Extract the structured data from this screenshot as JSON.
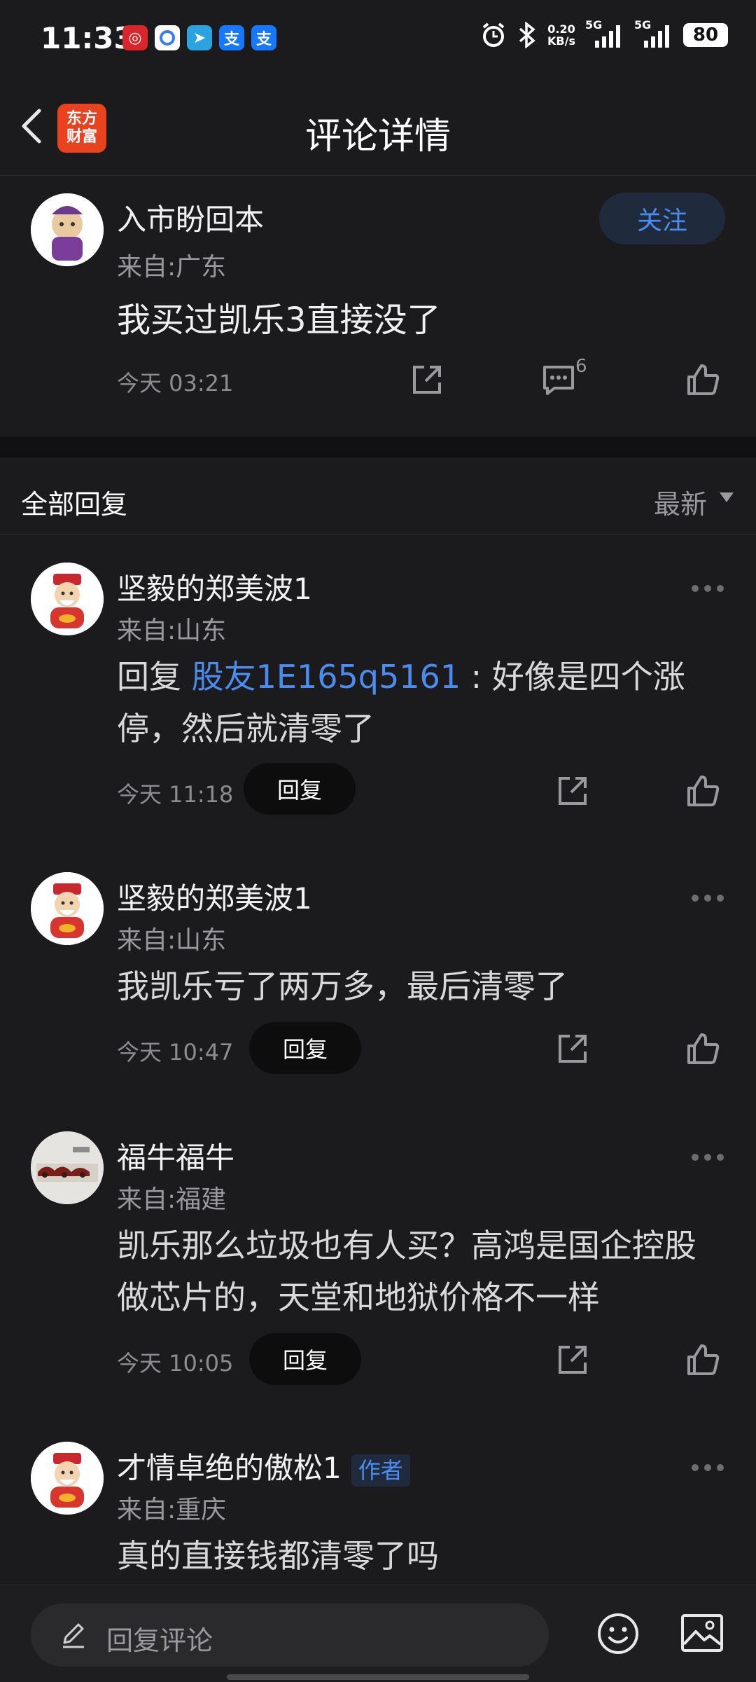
{
  "status_bar": {
    "time": "11:33",
    "net_speed_value": "0.20",
    "net_speed_unit": "KB/s",
    "signal1": "5G",
    "signal2": "5G",
    "battery": "80",
    "app_icons": [
      "app-icon-red",
      "app-icon-browser",
      "app-icon-telegram",
      "app-icon-zhi1",
      "app-icon-zhi2"
    ],
    "zhi_label": "支"
  },
  "header": {
    "logo_line1": "东方",
    "logo_line2": "财富",
    "title": "评论详情"
  },
  "main_post": {
    "username": "入市盼回本",
    "location": "来自:广东",
    "content": "我买过凯乐3直接没了",
    "time": "今天 03:21",
    "comment_count": "6",
    "follow_label": "关注"
  },
  "replies_section": {
    "title": "全部回复",
    "sort_label": "最新"
  },
  "comments": [
    {
      "username": "坚毅的郑美波1",
      "location": "来自:山东",
      "reply_prefix": "回复 ",
      "mention": "股友1E165q5161",
      "text_after_mention": " : 好像是四个涨停，然后就清零了",
      "time": "今天 11:18",
      "reply_label": "回复"
    },
    {
      "username": "坚毅的郑美波1",
      "location": "来自:山东",
      "text": "我凯乐亏了两万多，最后清零了",
      "time": "今天 10:47",
      "reply_label": "回复"
    },
    {
      "username": "福牛福牛",
      "location": "来自:福建",
      "text": "凯乐那么垃圾也有人买？高鸿是国企控股做芯片的，天堂和地狱价格不一样",
      "time": "今天 10:05",
      "reply_label": "回复"
    },
    {
      "username": "才情卓绝的傲松1",
      "author_tag": "作者",
      "location": "来自:重庆",
      "text": "真的直接钱都清零了吗"
    }
  ],
  "bottom_bar": {
    "placeholder": "回复评论"
  },
  "colors": {
    "background": "#1b1b1d",
    "accent_blue": "#4a8cf0",
    "brand_orange": "#e8421e"
  }
}
